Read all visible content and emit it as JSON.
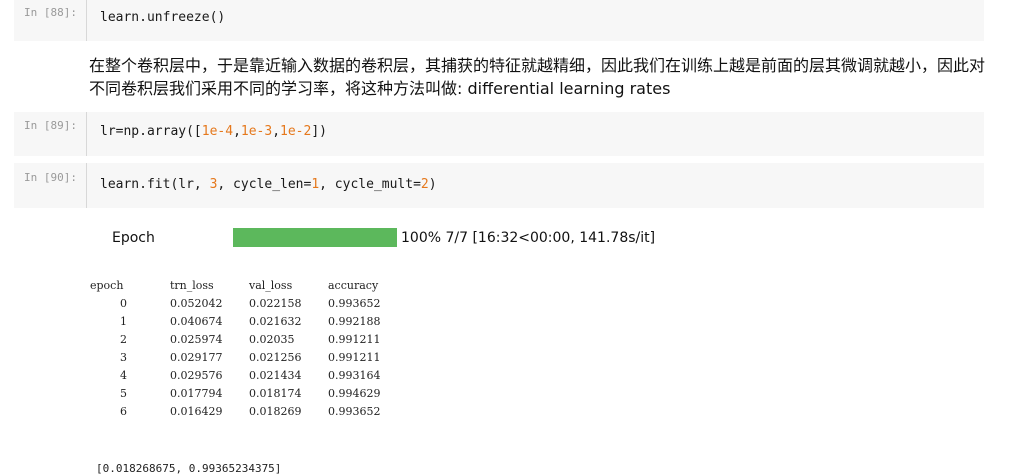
{
  "cells": {
    "c88": {
      "prompt": "In [88]:",
      "code": "learn.unfreeze()"
    },
    "c89": {
      "prompt": "In [89]:",
      "prefix": "lr=np.array([",
      "n1": "1e-4",
      "sep1": ",",
      "n2": "1e-3",
      "sep2": ",",
      "n3": "1e-2",
      "suffix": "])"
    },
    "c90": {
      "prompt": "In [90]:",
      "prefix": "learn.fit(lr, ",
      "n1": "3",
      "mid": ", cycle_len=",
      "n2": "1",
      "mid2": ", cycle_mult=",
      "n3": "2",
      "suffix": ")"
    }
  },
  "markdown": {
    "text": "在整个卷积层中，于是靠近输入数据的卷积层，其捕获的特征就越精细，因此我们在训练上越是前面的层其微调就越小，因此对不同卷积层我们采用不同的学习率，将这种方法叫做: differential learning rates"
  },
  "progress": {
    "label": "Epoch",
    "fraction": 1.0,
    "status": "100% 7/7 [16:32<00:00, 141.78s/it]",
    "fill_color": "#5cb85c"
  },
  "results": {
    "headers": [
      "epoch",
      "trn_loss",
      "val_loss",
      "accuracy"
    ],
    "rows": [
      [
        "0",
        "0.052042",
        "0.022158",
        "0.993652"
      ],
      [
        "1",
        "0.040674",
        "0.021632",
        "0.992188"
      ],
      [
        "2",
        "0.025974",
        "0.02035",
        "0.991211"
      ],
      [
        "3",
        "0.029177",
        "0.021256",
        "0.991211"
      ],
      [
        "4",
        "0.029576",
        "0.021434",
        "0.993164"
      ],
      [
        "5",
        "0.017794",
        "0.018174",
        "0.994629"
      ],
      [
        "6",
        "0.016429",
        "0.018269",
        "0.993652"
      ]
    ]
  },
  "final_output": "[0.018268675, 0.99365234375]"
}
